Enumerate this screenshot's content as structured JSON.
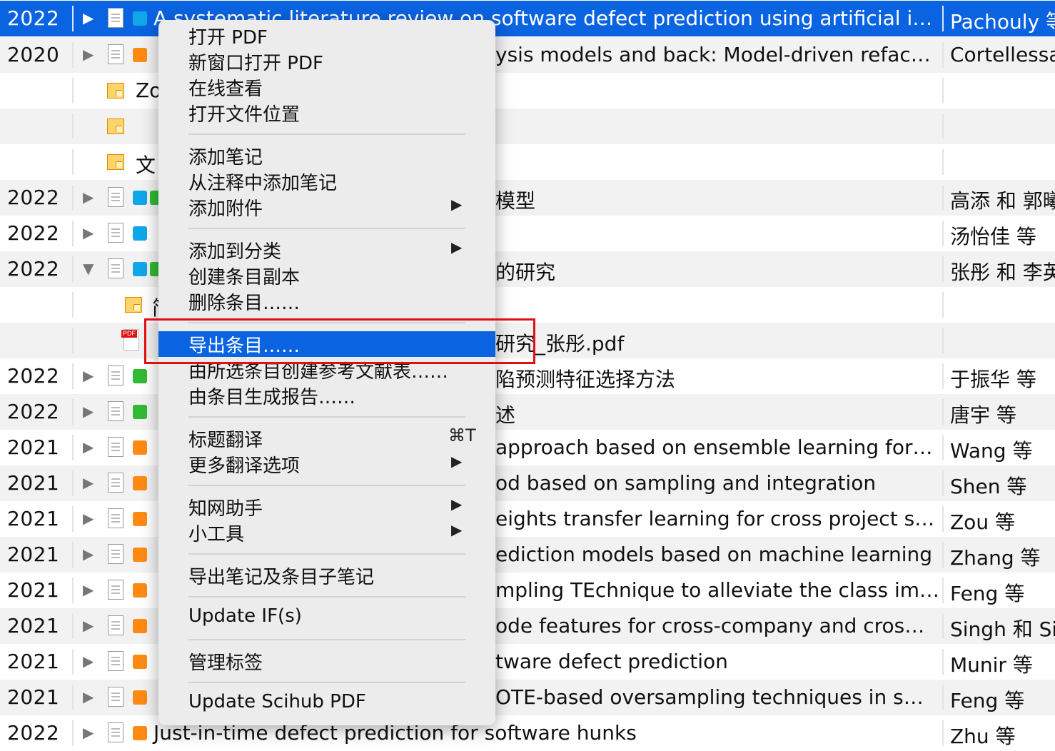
{
  "colors": {
    "selected_row": "#0a63e0",
    "tag_blue": "#10a6e8",
    "tag_orange": "#ff8a14",
    "tag_green": "#32b935",
    "highlight_box": "#e01010"
  },
  "rows": [
    {
      "year": "2022",
      "vis_text": "A systematic literature review on software defect prediction using artificial i…",
      "creator": "Pachouly 等"
    },
    {
      "year": "2020",
      "vis_text": "ysis models and back: Model-driven refac…",
      "creator": "Cortellessa"
    },
    {
      "year": "",
      "vis_text": "Zo",
      "creator": ""
    },
    {
      "year": "",
      "vis_text": "",
      "creator": ""
    },
    {
      "year": "",
      "vis_text": "文",
      "creator": ""
    },
    {
      "year": "2022",
      "vis_text": "模型",
      "creator": "高添 和 郭曦"
    },
    {
      "year": "2022",
      "vis_text": "",
      "creator": "汤怡佳 等"
    },
    {
      "year": "2022",
      "vis_text": "的研究",
      "creator": "张彤 和 李英"
    },
    {
      "year": "",
      "vis_text": "简",
      "creator": ""
    },
    {
      "year": "",
      "vis_text": "研究_张彤.pdf",
      "creator": ""
    },
    {
      "year": "2022",
      "vis_text": "陷预测特征选择方法",
      "creator": "于振华 等"
    },
    {
      "year": "2022",
      "vis_text": "述",
      "creator": "唐宇 等"
    },
    {
      "year": "2021",
      "vis_text": "approach based on ensemble learning for…",
      "creator": "Wang 等"
    },
    {
      "year": "2021",
      "vis_text": "od based on sampling and integration",
      "creator": "Shen 等"
    },
    {
      "year": "2021",
      "vis_text": "eights transfer learning for cross project s…",
      "creator": "Zou 等"
    },
    {
      "year": "2021",
      "vis_text": "ediction models based on machine learning",
      "creator": "Zhang 等"
    },
    {
      "year": "2021",
      "vis_text": "mpling TEchnique to alleviate the class im…",
      "creator": "Feng 等"
    },
    {
      "year": "2021",
      "vis_text": "ode features for cross-company and cros…",
      "creator": "Singh 和 Si"
    },
    {
      "year": "2021",
      "vis_text": "tware defect prediction",
      "creator": "Munir 等"
    },
    {
      "year": "2021",
      "vis_text": "OTE-based oversampling techniques in s…",
      "creator": "Feng 等"
    },
    {
      "year": "2022",
      "vis_text": "Just-in-time defect prediction for software hunks",
      "creator": "Zhu 等"
    }
  ],
  "menu": {
    "items": [
      "打开 PDF",
      "新窗口打开 PDF",
      "在线查看",
      "打开文件位置",
      "添加笔记",
      "从注释中添加笔记",
      "添加附件",
      "添加到分类",
      "创建条目副本",
      "删除条目……",
      "导出条目……",
      "由所选条目创建参考文献表……",
      "由条目生成报告……",
      "标题翻译",
      "更多翻译选项",
      "知网助手",
      "小工具",
      "导出笔记及条目子笔记",
      "Update IF(s)",
      "管理标签",
      "Update Scihub PDF"
    ],
    "shortcut_translate": "⌘T"
  }
}
